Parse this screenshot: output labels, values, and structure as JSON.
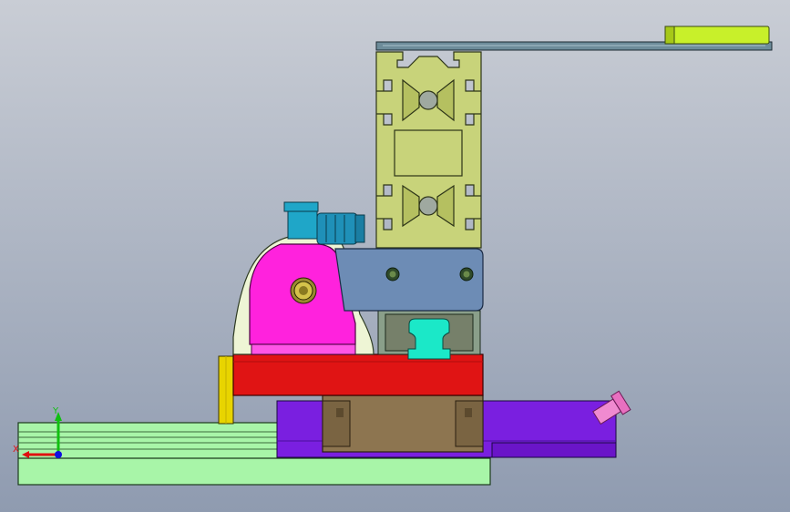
{
  "viewport": {
    "background_top": "#c9cdd5",
    "background_bottom": "#8f9bb0"
  },
  "triad": {
    "x_label": "X",
    "y_label": "Y",
    "x_color": "#e01010",
    "y_color": "#10c010",
    "z_color": "#1010e0"
  },
  "parts": {
    "base_rail_color": "#a8f5a8",
    "guide_rail_color": "#e6e6e6",
    "purple_cylinder_color": "#7a1fe0",
    "brown_carriage_color": "#8d7550",
    "red_plate_color": "#e01414",
    "yellow_post_color": "#e8d400",
    "magenta_bracket_color": "#ff22dd",
    "white_bracket_color": "#eef5d5",
    "blue_plate_color": "#6d8cb5",
    "cyan_fitting_color": "#1fa6c8",
    "teal_block_color": "#1be8c8",
    "profile_color": "#c8d37a",
    "top_arm_color": "#6d8c9a",
    "top_pad_color": "#c8f02a",
    "pink_fitting_color": "#f08ad0"
  }
}
